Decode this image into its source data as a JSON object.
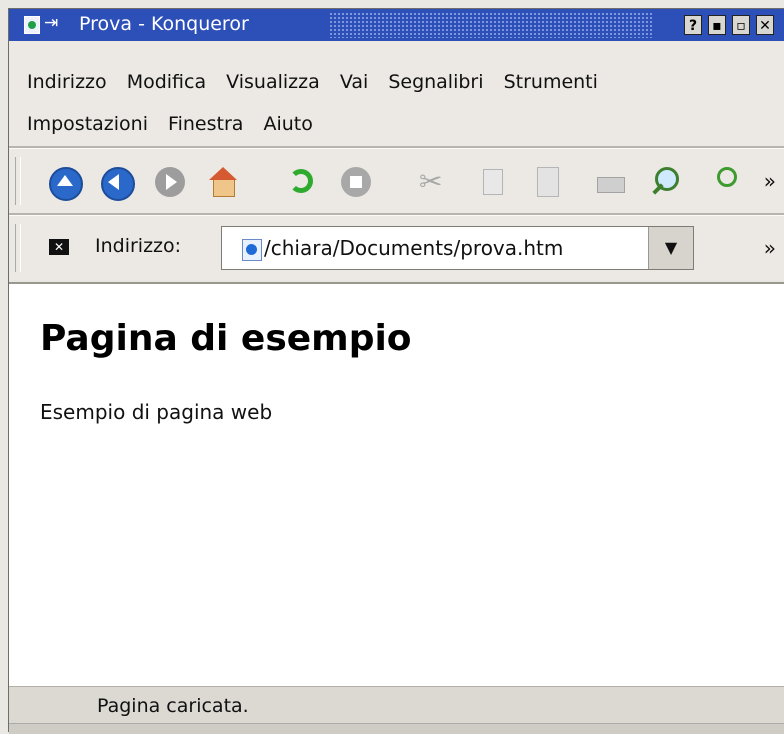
{
  "window": {
    "title": "Prova - Konqueror",
    "buttons": [
      "?",
      "▪",
      "▫",
      "✕"
    ]
  },
  "menubar": {
    "row1": [
      {
        "label": "Indirizzo"
      },
      {
        "label": "Modifica"
      },
      {
        "label": "Visualizza"
      },
      {
        "label": "Vai"
      },
      {
        "label": "Segnalibri"
      },
      {
        "label": "Strumenti"
      }
    ],
    "row2": [
      {
        "label": "Impostazioni"
      },
      {
        "label": "Finestra"
      },
      {
        "label": "Aiuto"
      }
    ]
  },
  "toolbar": {
    "icons": [
      "up-icon",
      "back-icon",
      "forward-icon",
      "home-icon",
      "reload-icon",
      "stop-icon",
      "cut-icon",
      "copy-icon",
      "paste-icon",
      "print-icon",
      "zoom-icon",
      "find-icon"
    ],
    "more": "»"
  },
  "location": {
    "label": "Indirizzo:",
    "url": "/chiara/Documents/prova.htm",
    "more": "»"
  },
  "page": {
    "heading": "Pagina di esempio",
    "text": "Esempio di pagina web"
  },
  "status": {
    "text": "Pagina caricata."
  },
  "colors": {
    "titlebar": "#2d4fb8",
    "icon_blue": "#2a68c9",
    "icon_gray": "#9d9d9d",
    "reload_green": "#2eaa2e"
  }
}
